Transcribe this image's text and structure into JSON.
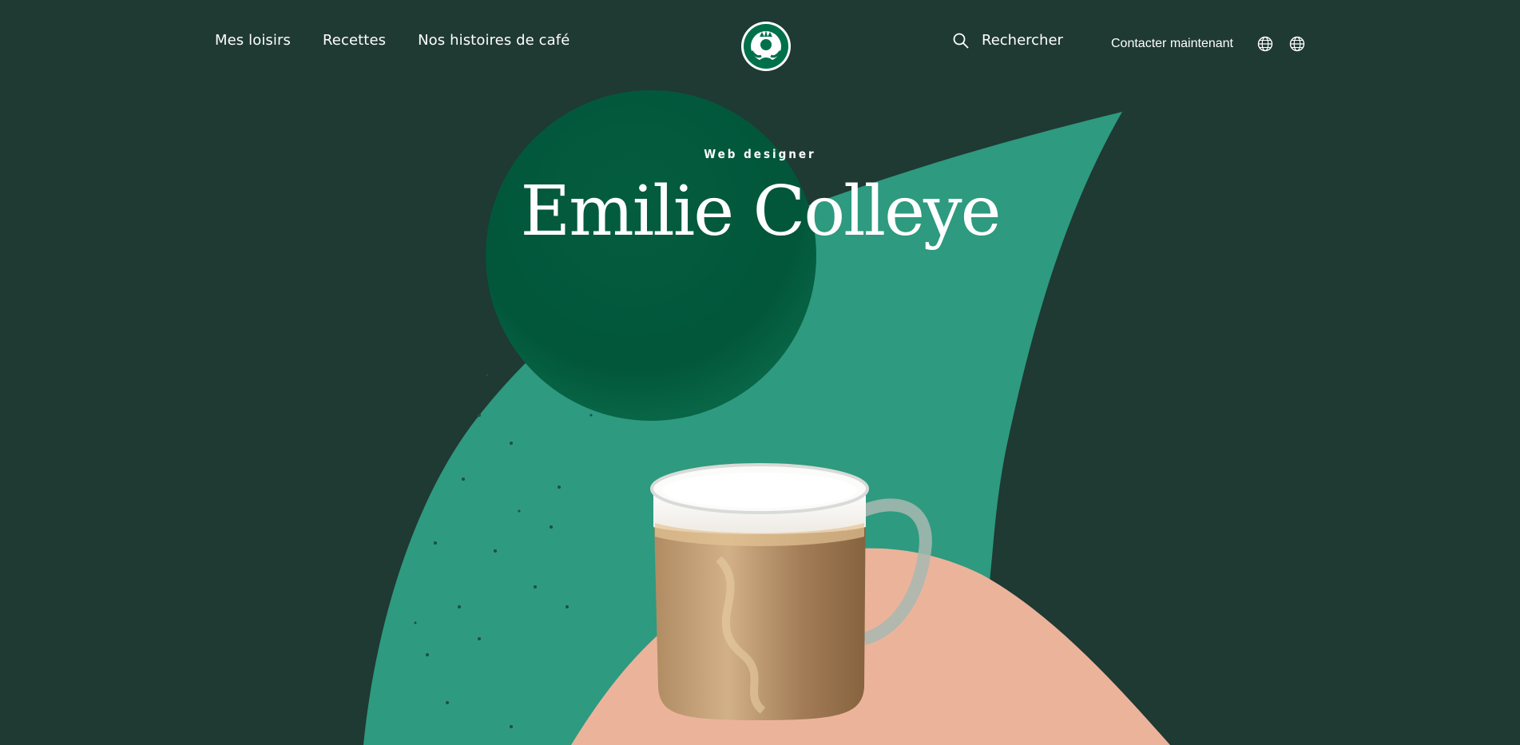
{
  "nav": {
    "links": [
      "Mes loisirs",
      "Recettes",
      "Nos histoires de café"
    ],
    "search_label": "Rechercher",
    "contact_label": "Contacter maintenant",
    "logo_icon": "starbucks-siren-logo",
    "search_icon": "search-icon",
    "globe_icon": "globe-icon"
  },
  "hero": {
    "subtitle": "Web designer",
    "title": "Emilie Colleye"
  },
  "colors": {
    "background": "#1f3933",
    "leaf_green": "#2e9a80",
    "circle_green": "#02563a",
    "peach": "#ecb39b",
    "logo_green": "#00704a"
  }
}
